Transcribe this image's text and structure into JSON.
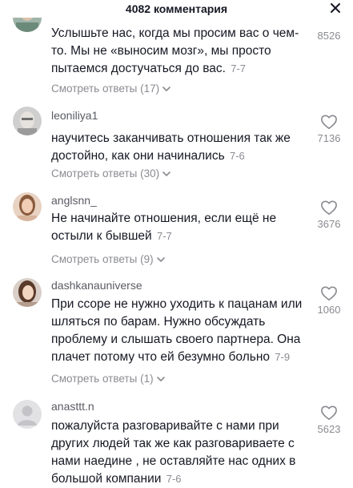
{
  "header": {
    "title": "4082 комментария",
    "close_icon": "close-icon"
  },
  "comments": [
    {
      "username": "",
      "text": "Услышьте нас, когда мы просим вас о чем-то. Мы не «выносим мозг», мы просто пытаемся достучаться до вас.",
      "date": "7-7",
      "replies": "Смотреть ответы (17)",
      "likes": "8526"
    },
    {
      "username": "leoniliya1",
      "text": "научитесь заканчивать отношения так же достойно, как они начинались",
      "date": "7-6",
      "replies": "Смотреть ответы (30)",
      "likes": "7136"
    },
    {
      "username": "anglsnn_",
      "text": "Не начинайте отношения, если ещё не остыли к бывшей",
      "date": "7-7",
      "replies": "Смотреть ответы (9)",
      "likes": "3676"
    },
    {
      "username": "dashkanauniverse",
      "text": "При ссоре не нужно уходить к пацанам или шляться по барам. Нужно обсуждать проблему и слышать своего партнера. Она плачет потому что ей безумно больно",
      "date": "7-9",
      "replies": "Смотреть ответы (1)",
      "likes": "1060"
    },
    {
      "username": "anasttt.n",
      "text": "пожалуйста разговаривайте с нами при других людей так же как разговариваете с нами наедине , не оставляйте нас одних в большой компании",
      "date": "7-6",
      "replies": "",
      "likes": "5623"
    }
  ],
  "colors": {
    "text": "#161823",
    "muted": "#8a8b91",
    "username": "#5a5b63"
  }
}
